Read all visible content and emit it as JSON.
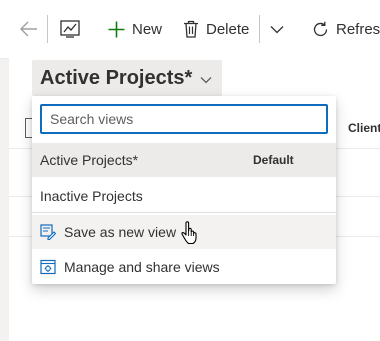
{
  "toolbar": {
    "back_icon": "back-arrow-icon",
    "chart_icon": "chart-icon",
    "new_label": "New",
    "delete_label": "Delete",
    "refresh_label": "Refresh"
  },
  "view": {
    "title": "Active Projects*",
    "column_header": "Client"
  },
  "view_selector": {
    "search_placeholder": "Search views",
    "items": [
      {
        "label": "Active Projects*",
        "badge": "Default",
        "selected": true
      },
      {
        "label": "Inactive Projects"
      }
    ],
    "actions": [
      {
        "label": "Save as new view",
        "icon": "save-view-icon"
      },
      {
        "label": "Manage and share views",
        "icon": "manage-views-icon"
      }
    ]
  },
  "colors": {
    "accent": "#0f6cbd",
    "add_icon": "#107c10",
    "selected_bg": "#edebe9"
  }
}
